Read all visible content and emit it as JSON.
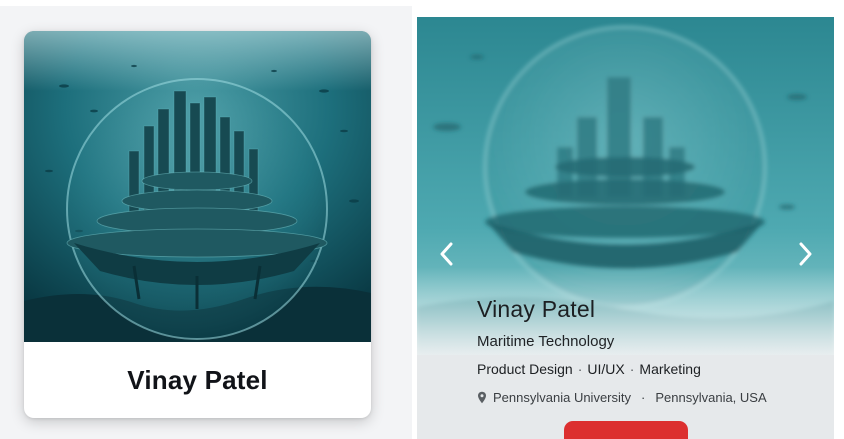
{
  "card": {
    "name": "Vinay Patel"
  },
  "profile": {
    "name": "Vinay Patel",
    "field": "Maritime Technology",
    "tags": [
      "Product Design",
      "UI/UX",
      "Marketing"
    ],
    "university": "Pennsylvania University",
    "location": "Pennsylvania, USA"
  },
  "icons": {
    "prev": "chevron-left-icon",
    "next": "chevron-right-icon",
    "location": "location-pin-icon"
  },
  "colors": {
    "accent": "#dc2f2f",
    "water": "#1d6f7c"
  }
}
